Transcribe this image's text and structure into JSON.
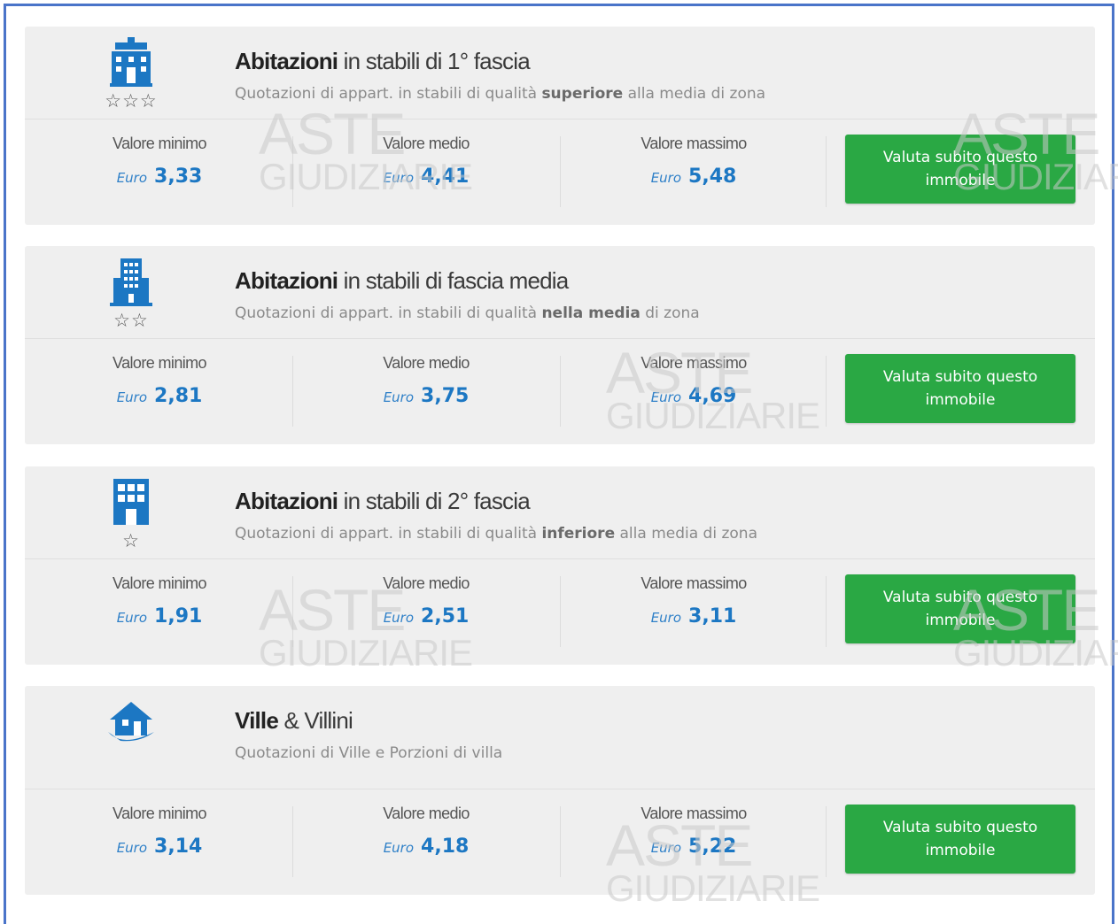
{
  "cards": [
    {
      "title_bold": "Abitazioni",
      "title_rest": " in stabili di 1° fascia",
      "sub_pre": "Quotazioni di appart. in stabili di qualità ",
      "sub_bold": "superiore",
      "sub_post": " alla media di zona",
      "stars": "☆☆☆",
      "icon": "luxury-building-icon",
      "min_label": "Valore minimo",
      "min_value": "3,33",
      "mid_label": "Valore medio",
      "mid_value": "4,41",
      "max_label": "Valore massimo",
      "max_value": "5,48",
      "currency": "Euro",
      "button": "Valuta subito questo immobile"
    },
    {
      "title_bold": "Abitazioni",
      "title_rest": " in stabili di fascia media",
      "sub_pre": "Quotazioni di appart. in stabili di qualità ",
      "sub_bold": "nella media",
      "sub_post": " di zona",
      "stars": "☆☆",
      "icon": "apartment-building-icon",
      "min_label": "Valore minimo",
      "min_value": "2,81",
      "mid_label": "Valore medio",
      "mid_value": "3,75",
      "max_label": "Valore massimo",
      "max_value": "4,69",
      "currency": "Euro",
      "button": "Valuta subito questo immobile"
    },
    {
      "title_bold": "Abitazioni",
      "title_rest": " in stabili di 2° fascia",
      "sub_pre": "Quotazioni di appart. in stabili di qualità ",
      "sub_bold": "inferiore",
      "sub_post": " alla media di zona",
      "stars": "☆",
      "icon": "office-building-icon",
      "min_label": "Valore minimo",
      "min_value": "1,91",
      "mid_label": "Valore medio",
      "mid_value": "2,51",
      "max_label": "Valore massimo",
      "max_value": "3,11",
      "currency": "Euro",
      "button": "Valuta subito questo immobile"
    },
    {
      "title_bold": "Ville",
      "title_rest": " & Villini",
      "sub_pre": "Quotazioni di Ville e Porzioni di villa",
      "sub_bold": "",
      "sub_post": "",
      "stars": "",
      "icon": "villa-house-icon",
      "min_label": "Valore minimo",
      "min_value": "3,14",
      "mid_label": "Valore medio",
      "mid_value": "4,18",
      "max_label": "Valore massimo",
      "max_value": "5,22",
      "currency": "Euro",
      "button": "Valuta subito questo immobile"
    }
  ],
  "watermark": {
    "line1": "ASTE",
    "line2": "GIUDIZIARIE"
  },
  "colors": {
    "accent_blue": "#1c77c3",
    "button_green": "#2aa844",
    "card_bg": "#efefef",
    "frame_blue": "#4a74c9"
  }
}
